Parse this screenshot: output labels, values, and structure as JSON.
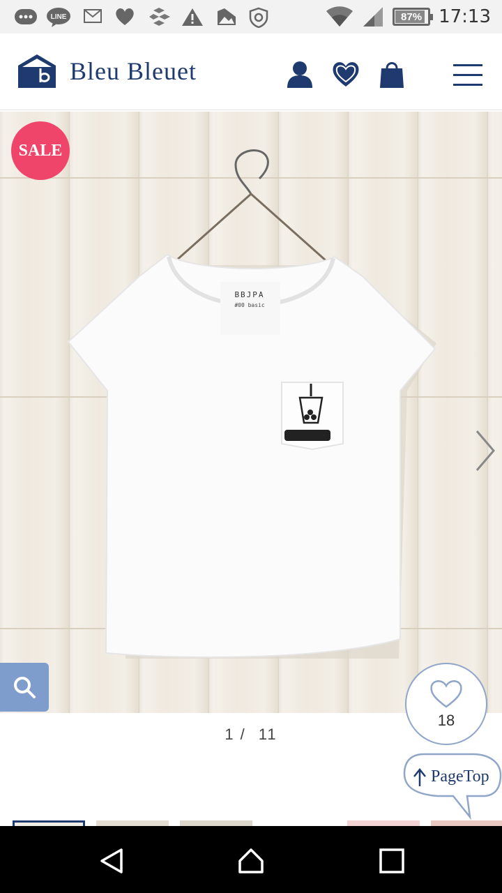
{
  "status_bar": {
    "time": "17:13",
    "battery": "87%",
    "battery_level": 0.87,
    "notification_icons": [
      "chat-bubble-icon",
      "line-app-icon",
      "mail-icon",
      "heart-icon",
      "cubes-icon",
      "warning-icon",
      "photo-icon",
      "shield-icon"
    ],
    "line_label": "LINE"
  },
  "header": {
    "brand": "Bleu Bleuet",
    "icons": [
      "account-icon",
      "favorites-heart-icon",
      "shopping-bag-icon",
      "hamburger-menu-icon"
    ],
    "brand_color": "#1e3a6e"
  },
  "product": {
    "badge": "SALE",
    "badge_color": "#f0456a",
    "label_brand": "BBJPA",
    "label_line": "#00 basic",
    "current_index": "1",
    "total": "11",
    "favorite_count": "18"
  },
  "page_top": {
    "label": "PageTop"
  },
  "colors": {
    "accent": "#7e9ccc",
    "circle_border": "#8fa6c9"
  }
}
